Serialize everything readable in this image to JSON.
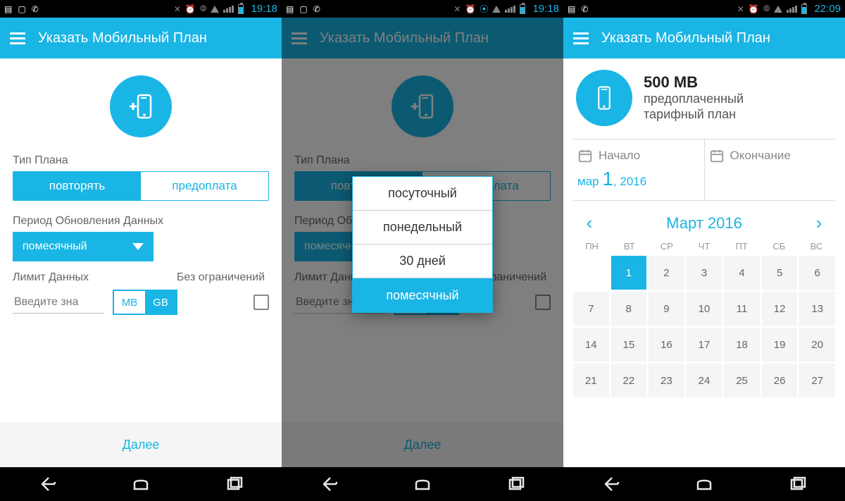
{
  "colors": {
    "accent": "#19b5e5"
  },
  "statusbar": {
    "time_a": "19:18",
    "time_b": "19:18",
    "time_c": "22:09"
  },
  "appbar": {
    "title": "Указать Мобильный План"
  },
  "plan": {
    "type_label": "Тип Плана",
    "repeat": "повторять",
    "prepaid": "предоплата",
    "period_label": "Период Обновления Данных",
    "period_value": "помесячный",
    "limit_label": "Лимит Данных",
    "unlimited_label": "Без ограничений",
    "input_placeholder": "Введите зна",
    "unit_mb": "MB",
    "unit_gb": "GB",
    "next": "Далее"
  },
  "period_options": {
    "daily": "посуточный",
    "weekly": "понедельный",
    "thirty": "30 дней",
    "monthly": "помесячный"
  },
  "summary": {
    "amount": "500 MB",
    "line1": "предоплаченный",
    "line2": "тарифный план"
  },
  "dates": {
    "start_label": "Начало",
    "end_label": "Окончание",
    "start_month": "мар",
    "start_day": "1",
    "start_year": "2016"
  },
  "calendar": {
    "month_title": "Март 2016",
    "dow": [
      "ПН",
      "ВТ",
      "СР",
      "ЧТ",
      "ПТ",
      "СБ",
      "ВС"
    ],
    "selected_day": 1,
    "days": [
      [
        "",
        "1",
        "2",
        "3",
        "4",
        "5",
        "6"
      ],
      [
        "7",
        "8",
        "9",
        "10",
        "11",
        "12",
        "13"
      ],
      [
        "14",
        "15",
        "16",
        "17",
        "18",
        "19",
        "20"
      ],
      [
        "21",
        "22",
        "23",
        "24",
        "25",
        "26",
        "27"
      ]
    ]
  }
}
